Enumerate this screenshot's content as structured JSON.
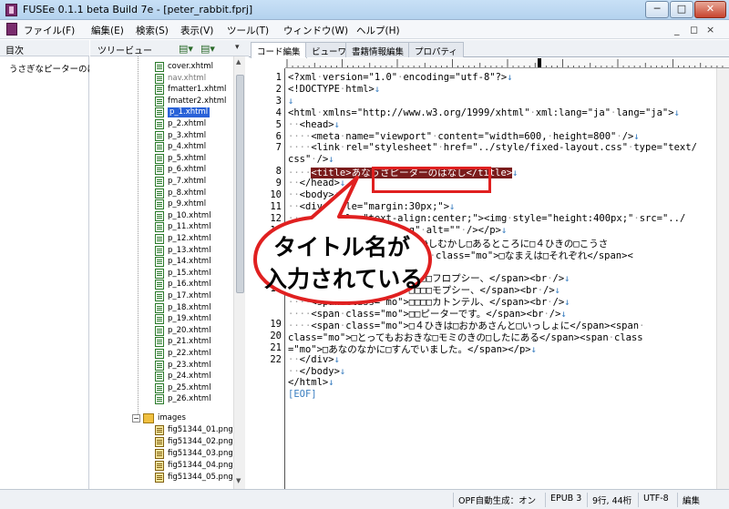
{
  "window": {
    "title": "FUSEe 0.1.1 beta Build 7e - [peter_rabbit.fprj]",
    "controls": {
      "minimize": "─",
      "maximize": "□",
      "close": "✕"
    }
  },
  "menu": {
    "items": [
      "ファイル(F)",
      "編集(E)",
      "検索(S)",
      "表示(V)",
      "ツール(T)",
      "ウィンドウ(W)",
      "ヘルプ(H)"
    ],
    "mdi_controls": {
      "minimize": "_",
      "restore": "◻",
      "close": "×"
    }
  },
  "toc": {
    "header": "目次",
    "items": [
      "うさぎなピーターのはなし"
    ]
  },
  "tree": {
    "header": "ツリービュー",
    "files": [
      "cover.xhtml",
      "nav.xhtml",
      "fmatter1.xhtml",
      "fmatter2.xhtml",
      "p_1.xhtml",
      "p_2.xhtml",
      "p_3.xhtml",
      "p_4.xhtml",
      "p_5.xhtml",
      "p_6.xhtml",
      "p_7.xhtml",
      "p_8.xhtml",
      "p_9.xhtml",
      "p_10.xhtml",
      "p_11.xhtml",
      "p_12.xhtml",
      "p_13.xhtml",
      "p_14.xhtml",
      "p_15.xhtml",
      "p_16.xhtml",
      "p_17.xhtml",
      "p_18.xhtml",
      "p_19.xhtml",
      "p_20.xhtml",
      "p_21.xhtml",
      "p_22.xhtml",
      "p_23.xhtml",
      "p_24.xhtml",
      "p_25.xhtml",
      "p_26.xhtml"
    ],
    "selected": "p_1.xhtml",
    "folder": "images",
    "images": [
      "fig51344_01.png",
      "fig51344_02.png",
      "fig51344_03.png",
      "fig51344_04.png",
      "fig51344_05.png"
    ]
  },
  "tabs": [
    "コード編集",
    "ビューワ",
    "書籍情報編集",
    "プロパティ"
  ],
  "active_tab": "コード編集",
  "editor": {
    "line_numbers": [
      "1",
      "2",
      "3",
      "4",
      "5",
      "6",
      "7",
      "",
      "8",
      "9",
      "10",
      "11",
      "12",
      "13",
      "14",
      "15",
      "16",
      "17",
      "18",
      "",
      "",
      "19",
      "20",
      "21",
      "22"
    ],
    "lines": [
      "<?xml·version=\"1.0\"·encoding=\"utf-8\"?>↓",
      "<!DOCTYPE·html>↓",
      "↓",
      "<html·xmlns=\"http://www.w3.org/1999/xhtml\"·xml:lang=\"ja\"·lang=\"ja\">↓",
      "··<head>↓",
      "····<meta·name=\"viewport\"·content=\"width=600,·height=800\"·/>↓",
      "····<link·rel=\"stylesheet\"·href=\"../style/fixed-layout.css\"·type=\"text/",
      "css\"·/>↓",
      "····<title>あなうさピーターのはなし</title>↓",
      "··</head>↓",
      "··<body>↓",
      "··<div·style=\"margin:30px;\">↓",
      "····<p·style=\"text-align:center;\"><img·style=\"height:400px;\"·src=\"../",
      "images/fig51344_01.png\"·alt=\"\"·/></p>↓",
      "····<span·class=\"mo\">むかしむかし□あるところに□４ひきの□こうさ",
      "ぎが□いました。</span><span·class=\"mo\">□なまえは□それぞれ</span><",
      "br·/>↓",
      "····<span·class=\"mo\">□□□□フロプシー、</span><br·/>↓",
      "····<span·class=\"mo\">□□□□モプシー、</span><br·/>↓",
      "····<span·class=\"mo\">□□□□カトンテル、</span><br·/>↓",
      "····<span·class=\"mo\">□□ピーターです。</span><br·/>↓",
      "····<span·class=\"mo\">□４ひきは□おかあさんと□いっしょに</span><span·",
      "class=\"mo\">□とってもおおきな□モミのきの□したにある</span><span·class",
      "=\"mo\">□あなのなかに□すんでいました。</span></p>↓",
      "··</div>↓",
      "··</body>↓",
      "</html>↓",
      "[EOF]"
    ],
    "title_highlight": "<title>あなうさピーターのはなし</title>"
  },
  "annotation": {
    "line1": "タイトル名が",
    "line2": "入力されている",
    "colors": {
      "box": "#e02020",
      "bubble_fill": "#ffffff"
    }
  },
  "status": {
    "opf": "OPF自動生成：オン",
    "format": "EPUB 3",
    "position": "9行, 44桁",
    "encoding": "UTF-8",
    "mode": "編集"
  }
}
